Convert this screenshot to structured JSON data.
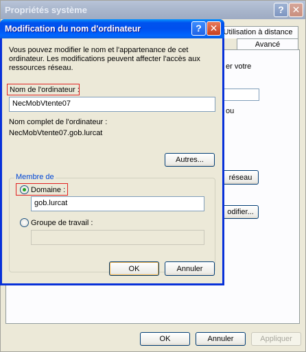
{
  "background_window": {
    "title": "Propriétés système",
    "help_icon": "?",
    "close_icon": "✕",
    "tabs": [
      {
        "label": "Utilisation à distance"
      },
      {
        "label": "Avancé"
      }
    ],
    "partial_texts": [
      {
        "text": "er votre"
      },
      {
        "text": "ou"
      }
    ],
    "network_button_label": "réseau",
    "modify_button_label": "odifier...",
    "footer_buttons": {
      "ok": "OK",
      "cancel": "Annuler",
      "apply": "Appliquer"
    }
  },
  "dialog": {
    "title": "Modification du nom d'ordinateur",
    "help_icon": "?",
    "close_icon": "✕",
    "intro_text": "Vous pouvez modifier le nom et l'appartenance de cet ordinateur. Les modifications peuvent affecter l'accès aux ressources réseau.",
    "computer_name_label": "Nom de l'ordinateur :",
    "computer_name_value": "NecMobVtente07",
    "full_name_label": "Nom complet de l'ordinateur :",
    "full_name_value": "NecMobVtente07.gob.lurcat",
    "more_button": "Autres...",
    "member_of": {
      "group_label": "Membre de",
      "domain_label": "Domaine :",
      "domain_value": "gob.lurcat",
      "domain_selected": true,
      "workgroup_label": "Groupe de travail :",
      "workgroup_value": ""
    },
    "ok_button": "OK",
    "cancel_button": "Annuler"
  }
}
